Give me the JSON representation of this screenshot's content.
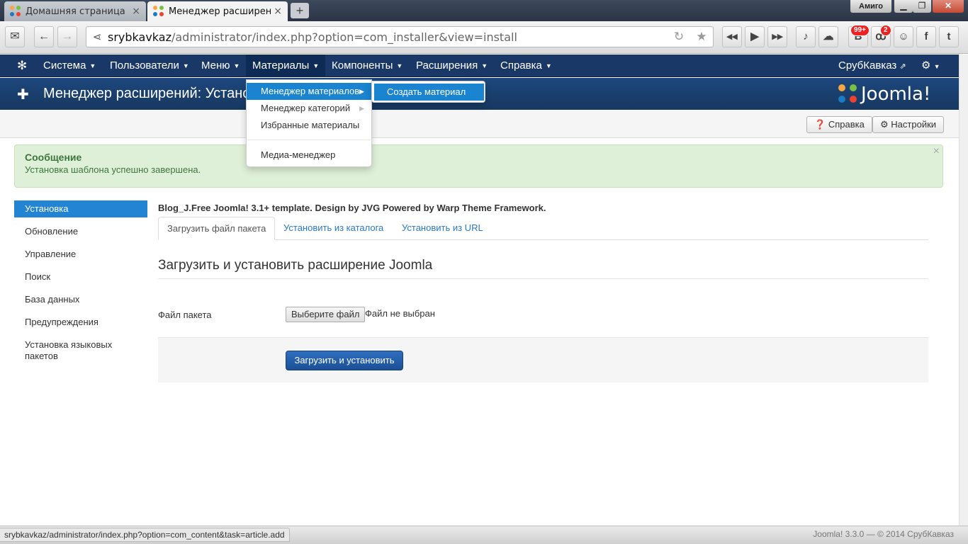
{
  "browser": {
    "tabs": [
      {
        "label": "Домашняя страница"
      },
      {
        "label": "Менеджер расширений - У"
      }
    ],
    "new_tab": "+",
    "user": "Амиго",
    "url_host": "srybkavkaz",
    "url_path": "/administrator/index.php?option=com_installer&view=install",
    "badge_vk": "99+",
    "badge_ok": "2",
    "status_url": "srybkavkaz/administrator/index.php?option=com_content&task=article.add"
  },
  "nav": {
    "items": [
      {
        "label": "Система"
      },
      {
        "label": "Пользователи"
      },
      {
        "label": "Меню"
      },
      {
        "label": "Материалы"
      },
      {
        "label": "Компоненты"
      },
      {
        "label": "Расширения"
      },
      {
        "label": "Справка"
      }
    ],
    "site_name": "СрубКавказ"
  },
  "dropdown": {
    "items": [
      {
        "label": "Менеджер материалов"
      },
      {
        "label": "Менеджер категорий"
      },
      {
        "label": "Избранные материалы"
      },
      {
        "label": "Медиа-менеджер"
      }
    ],
    "submenu": "Создать материал"
  },
  "header": {
    "title": "Менеджер расширений: Установка",
    "brand": "Joomla!"
  },
  "toolbar": {
    "help": "Справка",
    "options": "Настройки"
  },
  "alert": {
    "heading": "Сообщение",
    "body": "Установка шаблона успешно завершена."
  },
  "sidebar": {
    "items": [
      {
        "label": "Установка"
      },
      {
        "label": "Обновление"
      },
      {
        "label": "Управление"
      },
      {
        "label": "Поиск"
      },
      {
        "label": "База данных"
      },
      {
        "label": "Предупреждения"
      },
      {
        "label": "Установка языковых пакетов"
      }
    ]
  },
  "main": {
    "template_message": "Blog_J.Free Joomla! 3.1+ template. Design by JVG Powered by Warp Theme Framework.",
    "tabs": [
      {
        "label": "Загрузить файл пакета"
      },
      {
        "label": "Установить из каталога"
      },
      {
        "label": "Установить из URL"
      }
    ],
    "legend": "Загрузить и установить расширение Joomla",
    "file_label": "Файл пакета",
    "file_button": "Выберите файл",
    "file_status": "Файл не выбран",
    "submit": "Загрузить и установить"
  },
  "footer": {
    "version": "Joomla! 3.3.0  —  © 2014 СрубКавказ"
  },
  "colors": {
    "nav_bg": "#1a3867",
    "header_bg": "#1d477e",
    "accent": "#2384d3",
    "alert_bg": "#dff0d8",
    "alert_text": "#3c763d"
  }
}
